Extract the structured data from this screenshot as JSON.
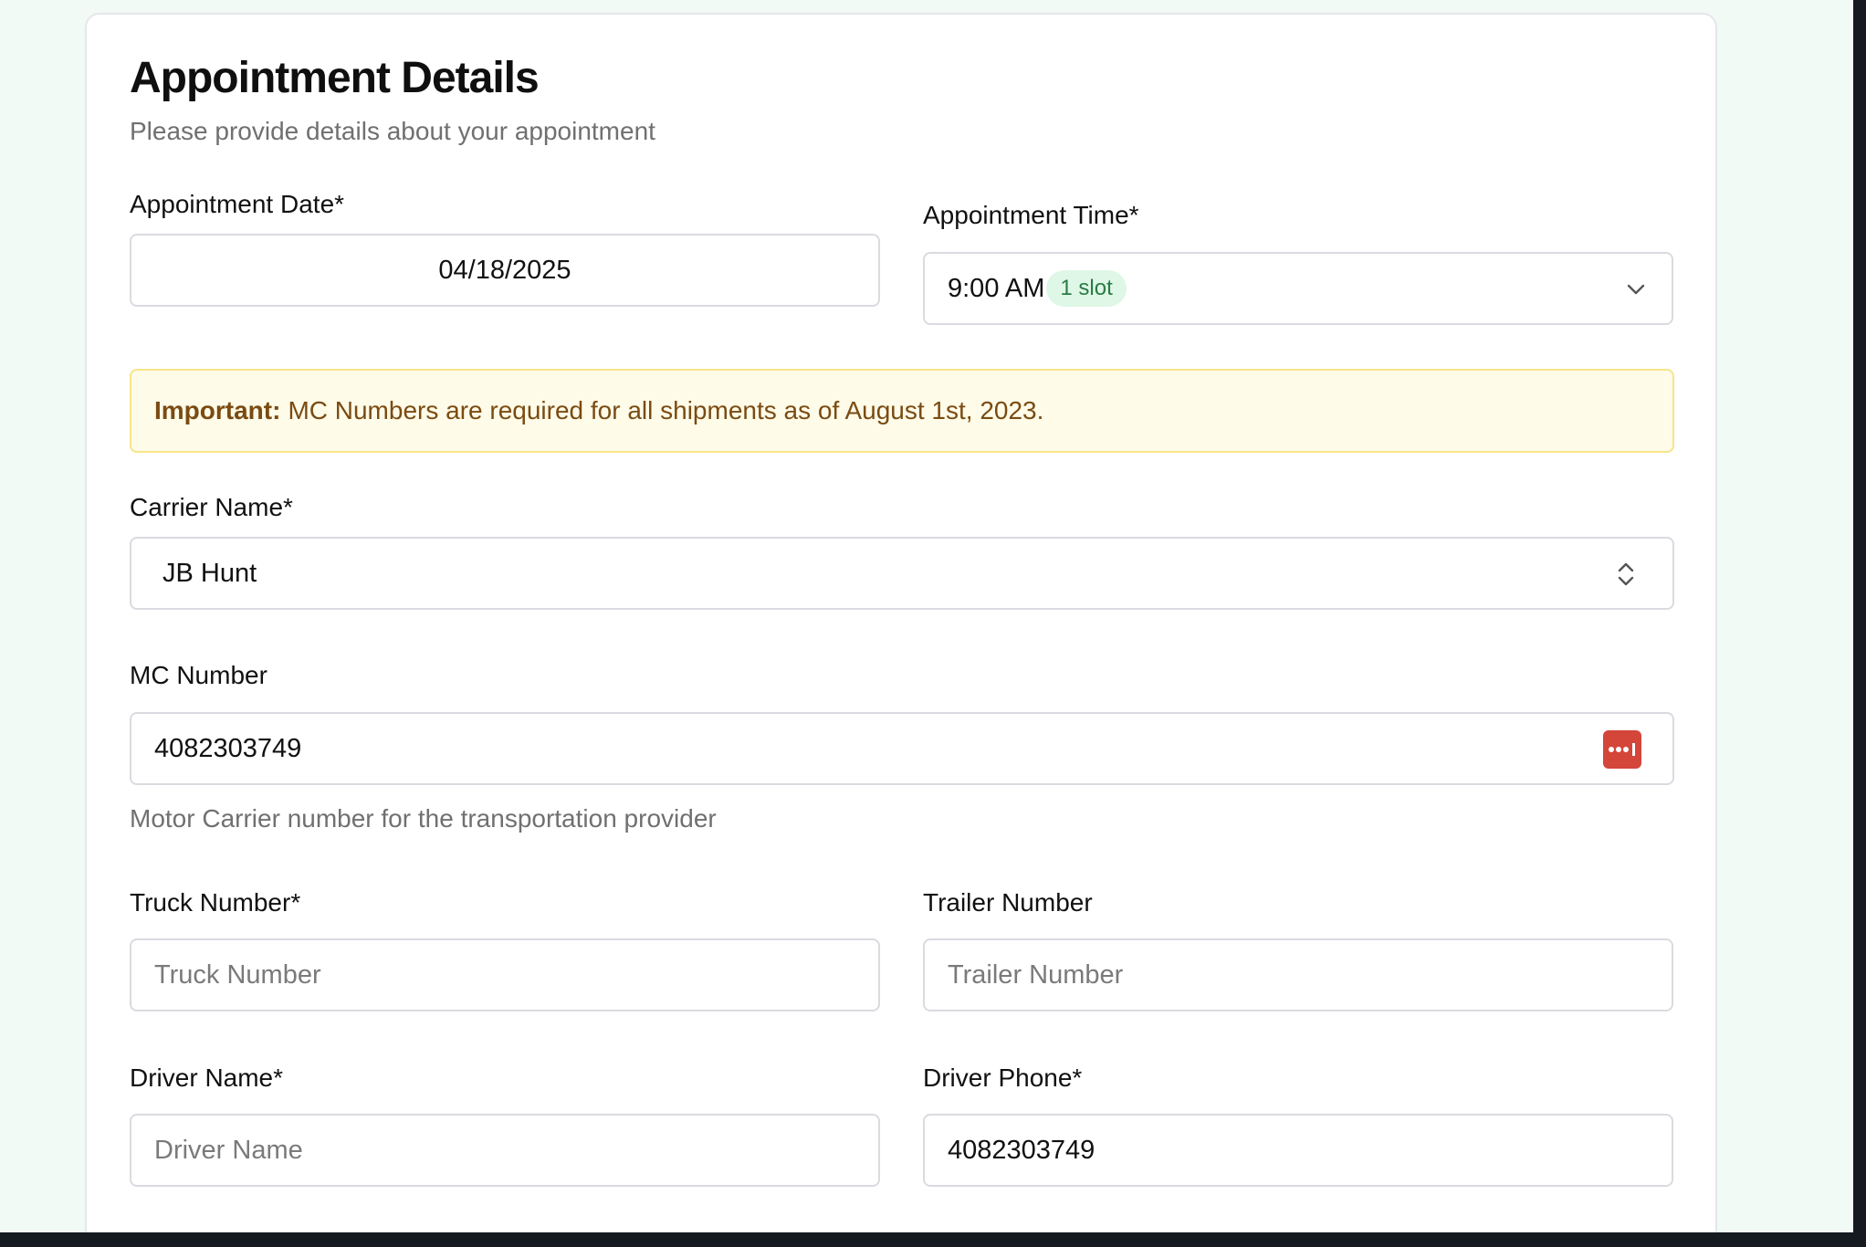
{
  "header": {
    "title": "Appointment Details",
    "subtitle": "Please provide details about your appointment"
  },
  "appointment_date": {
    "label": "Appointment Date*",
    "value": "04/18/2025"
  },
  "appointment_time": {
    "label": "Appointment Time*",
    "value": "9:00 AM",
    "badge": "1 slot",
    "options_visible": [
      "9:00 AM"
    ]
  },
  "notice": {
    "strong": "Important:",
    "text": "MC Numbers are required for all shipments as of August 1st, 2023."
  },
  "carrier_name": {
    "label": "Carrier Name*",
    "value": "JB Hunt"
  },
  "mc_number": {
    "label": "MC Number",
    "value": "4082303749",
    "helper": "Motor Carrier number for the transportation provider"
  },
  "truck_number": {
    "label": "Truck Number*",
    "placeholder": "Truck Number"
  },
  "trailer_number": {
    "label": "Trailer Number",
    "placeholder": "Trailer Number"
  },
  "driver_name": {
    "label": "Driver Name*",
    "placeholder": "Driver Name"
  },
  "driver_phone": {
    "label": "Driver Phone*",
    "value": "4082303749"
  },
  "colors": {
    "page_background": "#f1faf4",
    "badge_background": "#dff7e6",
    "badge_text": "#2a7a45",
    "notice_background": "#fefbe8",
    "notice_border": "#f6e58a",
    "notice_text": "#7a4b12",
    "password_manager_icon": "#d4453a"
  },
  "icons": {
    "time_dropdown": "chevron-down-icon",
    "carrier_select": "chevron-up-down-icon",
    "mc_field": "password-manager-icon"
  }
}
